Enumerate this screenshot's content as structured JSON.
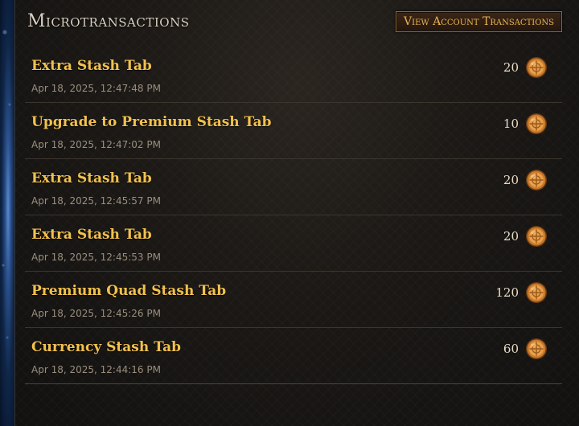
{
  "header": {
    "title": "Microtransactions",
    "view_button": "View Account Transactions"
  },
  "colors": {
    "item_name": "#f2c14e",
    "date": "#9a8e7e",
    "button_text": "#e7b453"
  },
  "currency_icon": "gold-coin-icon",
  "transactions": [
    {
      "name": "Extra Stash Tab",
      "date": "Apr 18, 2025, 12:47:48 PM",
      "price": "20"
    },
    {
      "name": "Upgrade to Premium Stash Tab",
      "date": "Apr 18, 2025, 12:47:02 PM",
      "price": "10"
    },
    {
      "name": "Extra Stash Tab",
      "date": "Apr 18, 2025, 12:45:57 PM",
      "price": "20"
    },
    {
      "name": "Extra Stash Tab",
      "date": "Apr 18, 2025, 12:45:53 PM",
      "price": "20"
    },
    {
      "name": "Premium Quad Stash Tab",
      "date": "Apr 18, 2025, 12:45:26 PM",
      "price": "120"
    },
    {
      "name": "Currency Stash Tab",
      "date": "Apr 18, 2025, 12:44:16 PM",
      "price": "60"
    }
  ]
}
